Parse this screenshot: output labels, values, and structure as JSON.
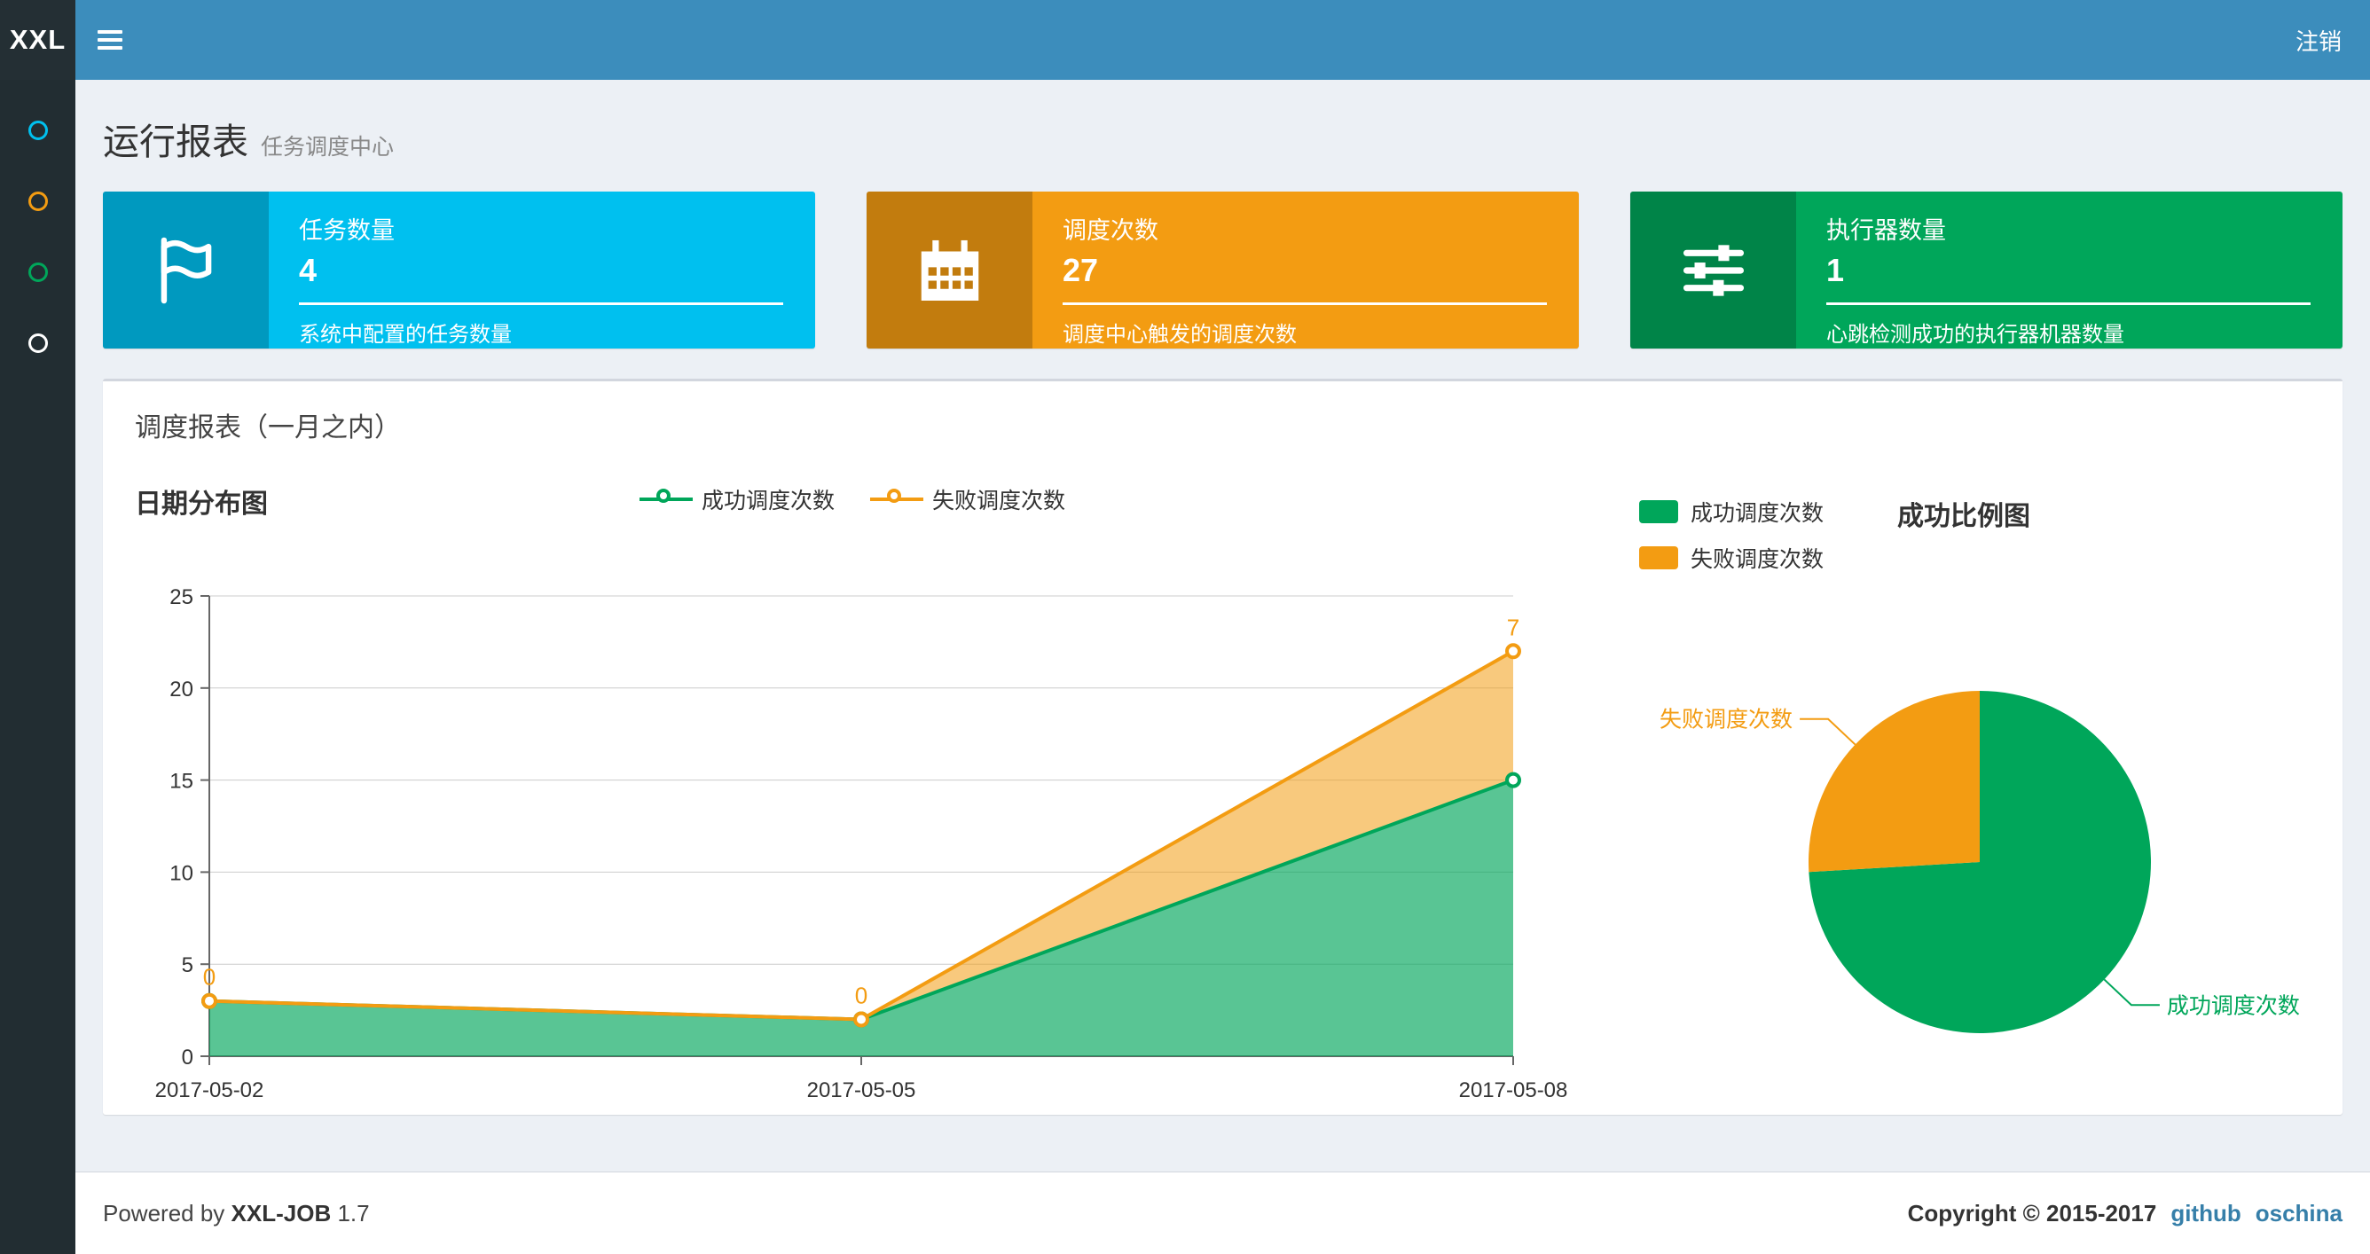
{
  "navbar": {
    "logo": "XXL",
    "logout_label": "注销"
  },
  "sidebar": {
    "items": [
      {
        "color": "#00c0ef"
      },
      {
        "color": "#f39c12"
      },
      {
        "color": "#00a65a"
      },
      {
        "color": "#ffffff"
      }
    ]
  },
  "page_header": {
    "title": "运行报表",
    "subtitle": "任务调度中心"
  },
  "info_boxes": [
    {
      "title": "任务数量",
      "value": "4",
      "desc": "系统中配置的任务数量",
      "color": "#00c0ef",
      "icon": "flag-icon"
    },
    {
      "title": "调度次数",
      "value": "27",
      "desc": "调度中心触发的调度次数",
      "color": "#f39c12",
      "icon": "calendar-icon"
    },
    {
      "title": "执行器数量",
      "value": "1",
      "desc": "心跳检测成功的执行器机器数量",
      "color": "#00a65a",
      "icon": "sliders-icon"
    }
  ],
  "panel": {
    "title": "调度报表（一月之内）"
  },
  "chart_data": [
    {
      "type": "area",
      "title": "日期分布图",
      "x": [
        "2017-05-02",
        "2017-05-05",
        "2017-05-08"
      ],
      "series": [
        {
          "name": "成功调度次数",
          "color": "#00a65a",
          "values": [
            3,
            2,
            15
          ]
        },
        {
          "name": "失败调度次数",
          "color": "#f39c12",
          "values": [
            0,
            0,
            7
          ]
        }
      ],
      "stacked": true,
      "ylim": [
        0,
        25
      ],
      "yticks": [
        0,
        5,
        10,
        15,
        20,
        25
      ],
      "grid": true,
      "legend_position": "top-center",
      "point_labels_series": "失败调度次数",
      "point_labels": [
        "0",
        "0",
        "7"
      ]
    },
    {
      "type": "pie",
      "title": "成功比例图",
      "slices": [
        {
          "name": "成功调度次数",
          "value": 20,
          "color": "#00a65a"
        },
        {
          "name": "失败调度次数",
          "value": 7,
          "color": "#f39c12"
        }
      ],
      "legend_position": "top-left"
    }
  ],
  "footer": {
    "powered_by": "Powered by",
    "brand": "XXL-JOB",
    "version": "1.7",
    "copyright": "Copyright © 2015-2017",
    "links": [
      {
        "label": "github"
      },
      {
        "label": "oschina"
      }
    ]
  }
}
